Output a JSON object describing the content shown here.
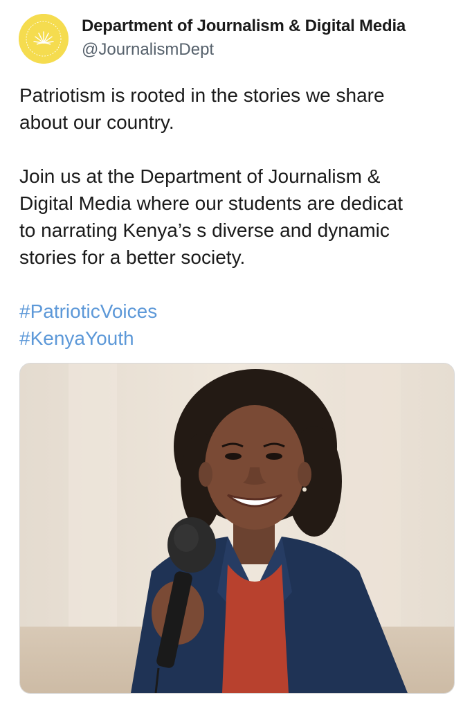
{
  "account": {
    "display_name": "Department of Journalism & Digital Media",
    "handle": "@JournalismDept",
    "avatar_icon": "sun-emblem-logo-icon",
    "avatar_color": "#f5dc4f"
  },
  "post": {
    "paragraphs": [
      "Patriotism is rooted in the stories we share\nabout our country.",
      "Join us at the Department of Journalism &\nDigital Media where our students are dedicat\nto narrating Kenya’s s diverse and dynamic\nstories for a better society."
    ],
    "hashtags": [
      "#PatrioticVoices",
      "#KenyaYouth"
    ],
    "hashtag_color": "#5c98d8"
  },
  "media": {
    "icon": "student-with-microphone-photo"
  }
}
